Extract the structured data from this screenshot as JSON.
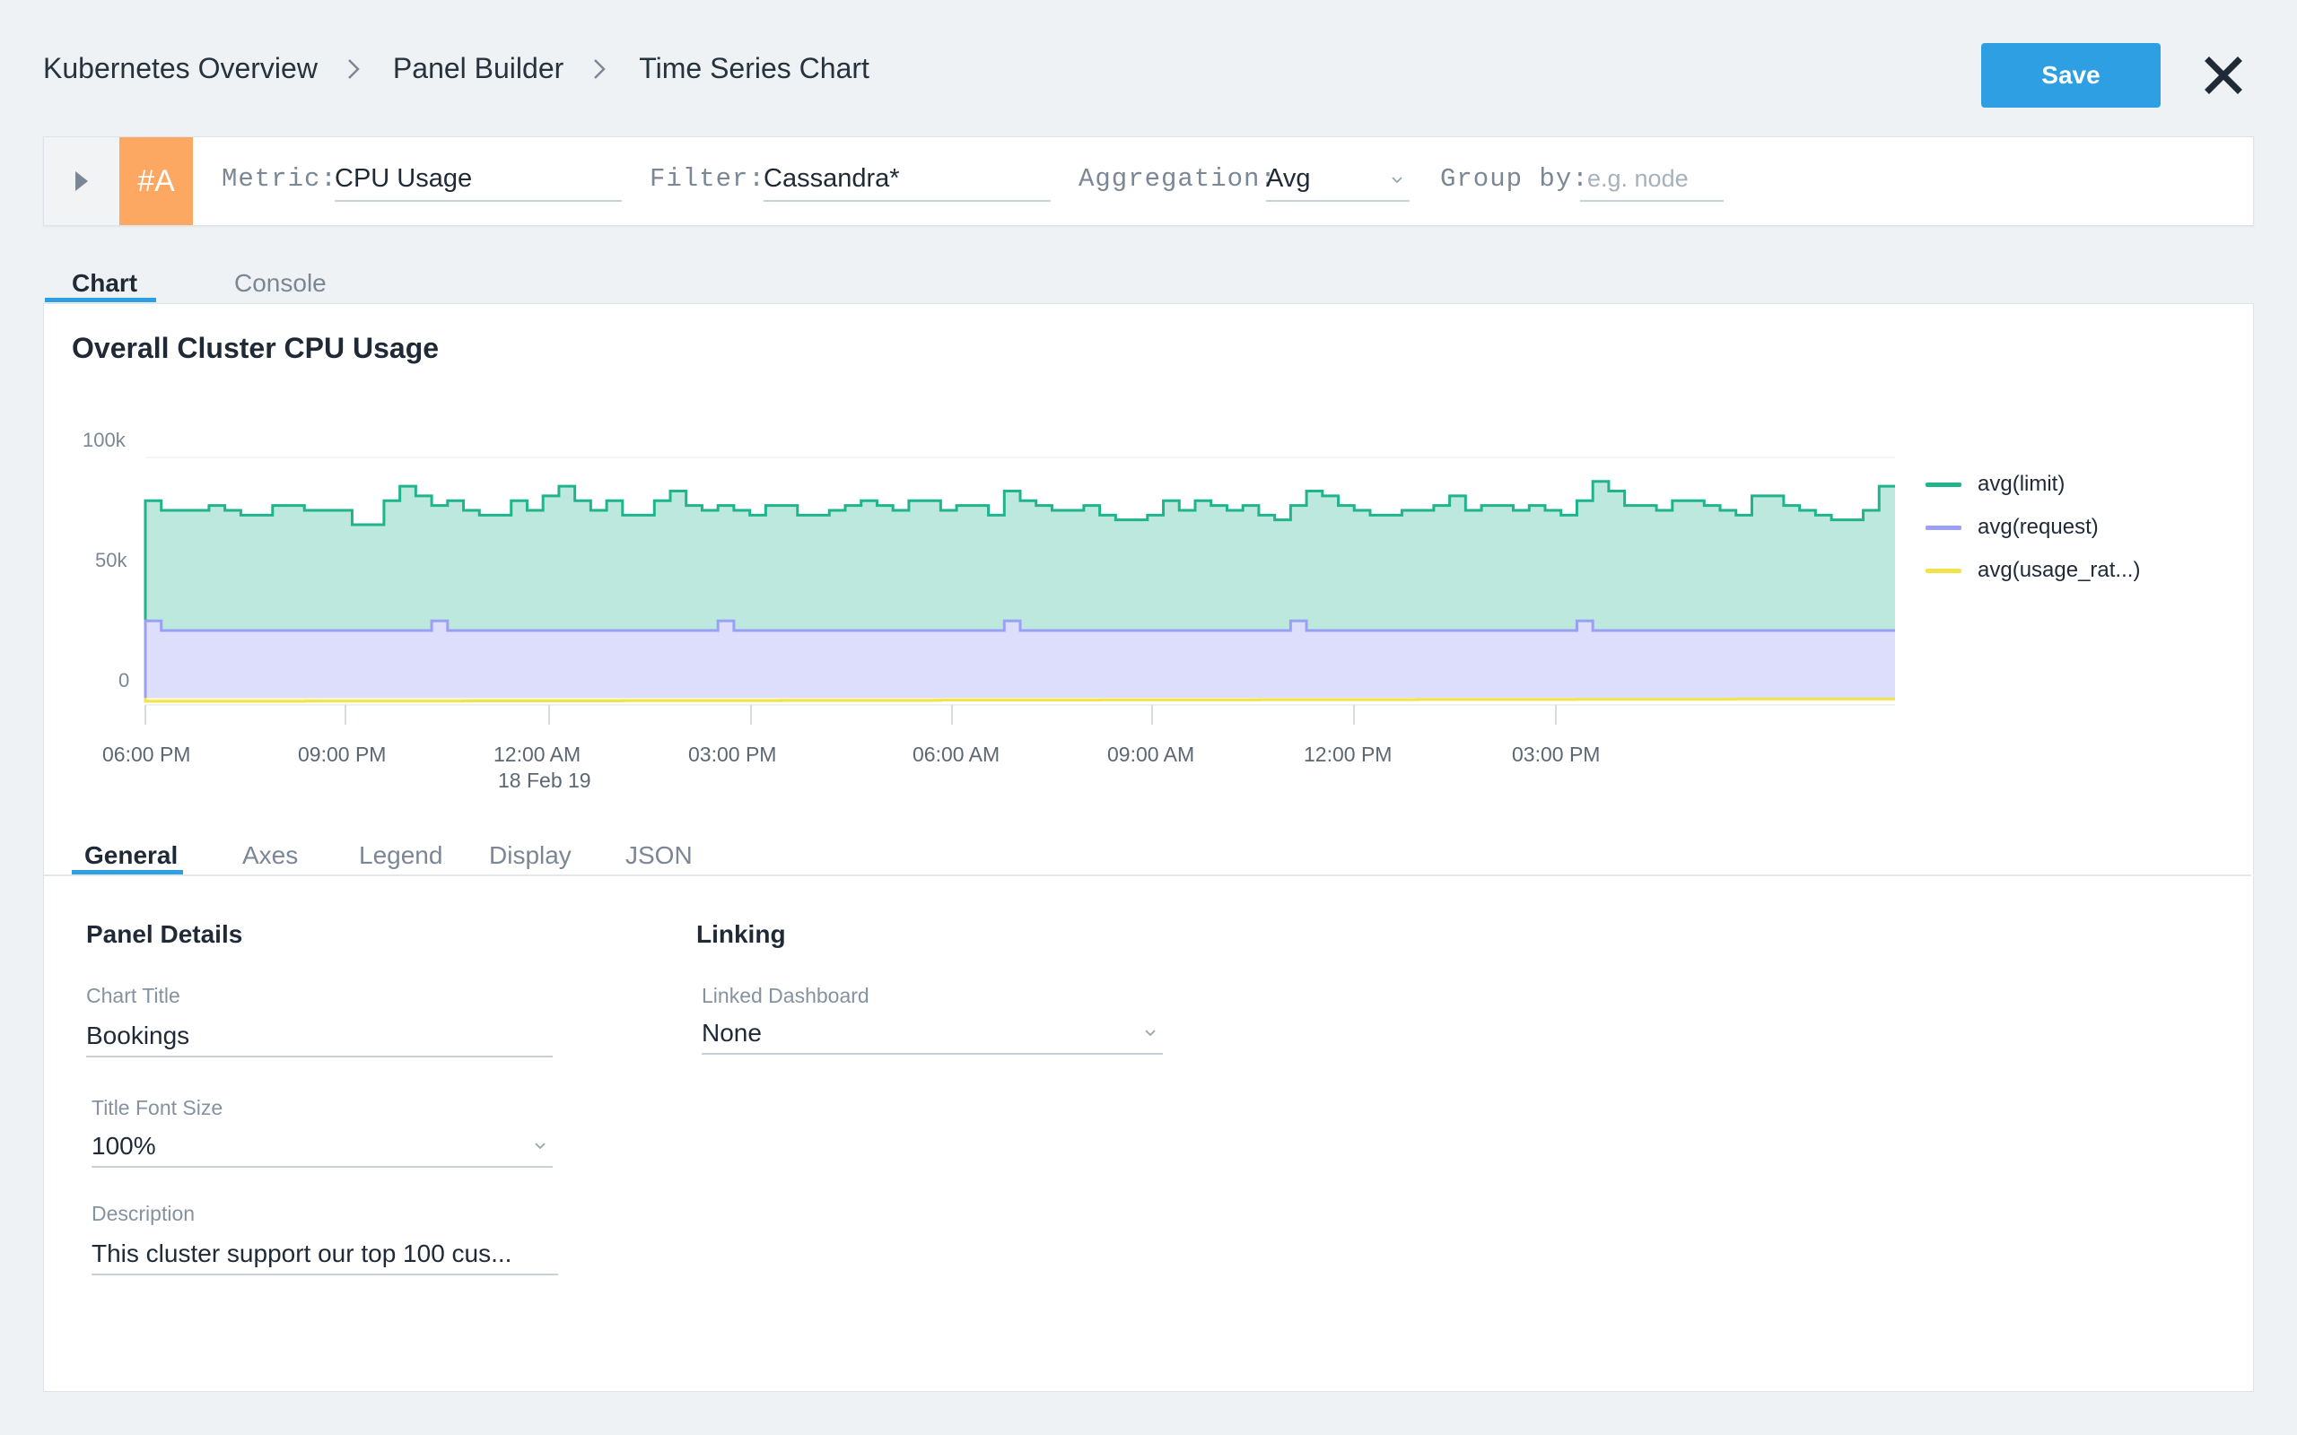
{
  "breadcrumb": [
    "Kubernetes Overview",
    "Panel Builder",
    "Time Series Chart"
  ],
  "header": {
    "save_label": "Save"
  },
  "query": {
    "id": "#A",
    "metric_label": "Metric:",
    "metric_value": "CPU Usage",
    "filter_label": "Filter:",
    "filter_value": "Cassandra*",
    "aggregation_label": "Aggregation:",
    "aggregation_value": "Avg",
    "groupby_label": "Group by:",
    "groupby_placeholder": "e.g. node",
    "id_color": "#fca863"
  },
  "view_tabs": [
    "Chart",
    "Console"
  ],
  "chart_data": {
    "type": "area",
    "title": "Overall Cluster CPU Usage",
    "y_ticks": [
      "100k",
      "50k",
      "0"
    ],
    "ylim": [
      0,
      100000
    ],
    "x_tick_labels": [
      "06:00 PM",
      "09:00 PM",
      "12:00 AM",
      "03:00 PM",
      "06:00 AM",
      "09:00 AM",
      "12:00 PM",
      "03:00 PM"
    ],
    "x_sub_label": "18 Feb 19",
    "legend_position": "right",
    "grid": true,
    "series": [
      {
        "name": "avg(limit)",
        "color": "#1fb48c",
        "fill": "#bde8dd",
        "values": [
          82000,
          78000,
          78000,
          78000,
          80000,
          78000,
          76000,
          76000,
          80000,
          80000,
          78000,
          78000,
          78000,
          72000,
          72000,
          82000,
          88000,
          84000,
          80000,
          82000,
          78000,
          76000,
          76000,
          82000,
          78000,
          84000,
          88000,
          82000,
          78000,
          82000,
          76000,
          76000,
          82000,
          86000,
          80000,
          78000,
          80000,
          78000,
          76000,
          80000,
          80000,
          76000,
          76000,
          78000,
          80000,
          82000,
          80000,
          78000,
          82000,
          82000,
          78000,
          80000,
          80000,
          76000,
          86000,
          82000,
          80000,
          78000,
          78000,
          80000,
          76000,
          74000,
          74000,
          76000,
          82000,
          78000,
          82000,
          80000,
          78000,
          80000,
          76000,
          74000,
          80000,
          86000,
          84000,
          80000,
          78000,
          76000,
          76000,
          78000,
          78000,
          80000,
          84000,
          78000,
          80000,
          80000,
          78000,
          80000,
          78000,
          76000,
          82000,
          90000,
          86000,
          80000,
          80000,
          78000,
          82000,
          82000,
          80000,
          78000,
          76000,
          84000,
          84000,
          80000,
          78000,
          76000,
          74000,
          74000,
          78000,
          88000
        ]
      },
      {
        "name": "avg(request)",
        "color": "#9aa0f5",
        "fill": "#dcdefb",
        "values": [
          32000,
          28000,
          28000,
          28000,
          28000,
          28000,
          28000,
          28000,
          28000,
          28000,
          28000,
          28000,
          28000,
          28000,
          28000,
          28000,
          28000,
          28000,
          32000,
          28000,
          28000,
          28000,
          28000,
          28000,
          28000,
          28000,
          28000,
          28000,
          28000,
          28000,
          28000,
          28000,
          28000,
          28000,
          28000,
          28000,
          32000,
          28000,
          28000,
          28000,
          28000,
          28000,
          28000,
          28000,
          28000,
          28000,
          28000,
          28000,
          28000,
          28000,
          28000,
          28000,
          28000,
          28000,
          32000,
          28000,
          28000,
          28000,
          28000,
          28000,
          28000,
          28000,
          28000,
          28000,
          28000,
          28000,
          28000,
          28000,
          28000,
          28000,
          28000,
          28000,
          32000,
          28000,
          28000,
          28000,
          28000,
          28000,
          28000,
          28000,
          28000,
          28000,
          28000,
          28000,
          28000,
          28000,
          28000,
          28000,
          28000,
          28000,
          32000,
          28000,
          28000,
          28000,
          28000,
          28000,
          28000,
          28000,
          28000,
          28000,
          28000,
          28000,
          28000,
          28000,
          28000,
          28000,
          28000,
          28000,
          28000,
          28000
        ]
      },
      {
        "name": "avg(usage_rat...)",
        "color": "#f1e44a",
        "fill": "#f8f5cf",
        "values": [
          -1500,
          -1400,
          -1300,
          -1200,
          -1100,
          -1000,
          -900,
          -800,
          -700,
          -600,
          -500
        ]
      }
    ]
  },
  "settings_tabs": [
    "General",
    "Axes",
    "Legend",
    "Display",
    "JSON"
  ],
  "panel_details": {
    "title": "Panel Details",
    "chart_title_label": "Chart Title",
    "chart_title_value": "Bookings",
    "font_size_label": "Title Font Size",
    "font_size_value": "100%",
    "description_label": "Description",
    "description_value": "This cluster support our top 100 cus..."
  },
  "linking": {
    "title": "Linking",
    "linked_dashboard_label": "Linked Dashboard",
    "linked_dashboard_value": "None"
  },
  "colors": {
    "accent": "#2d9fe2"
  }
}
